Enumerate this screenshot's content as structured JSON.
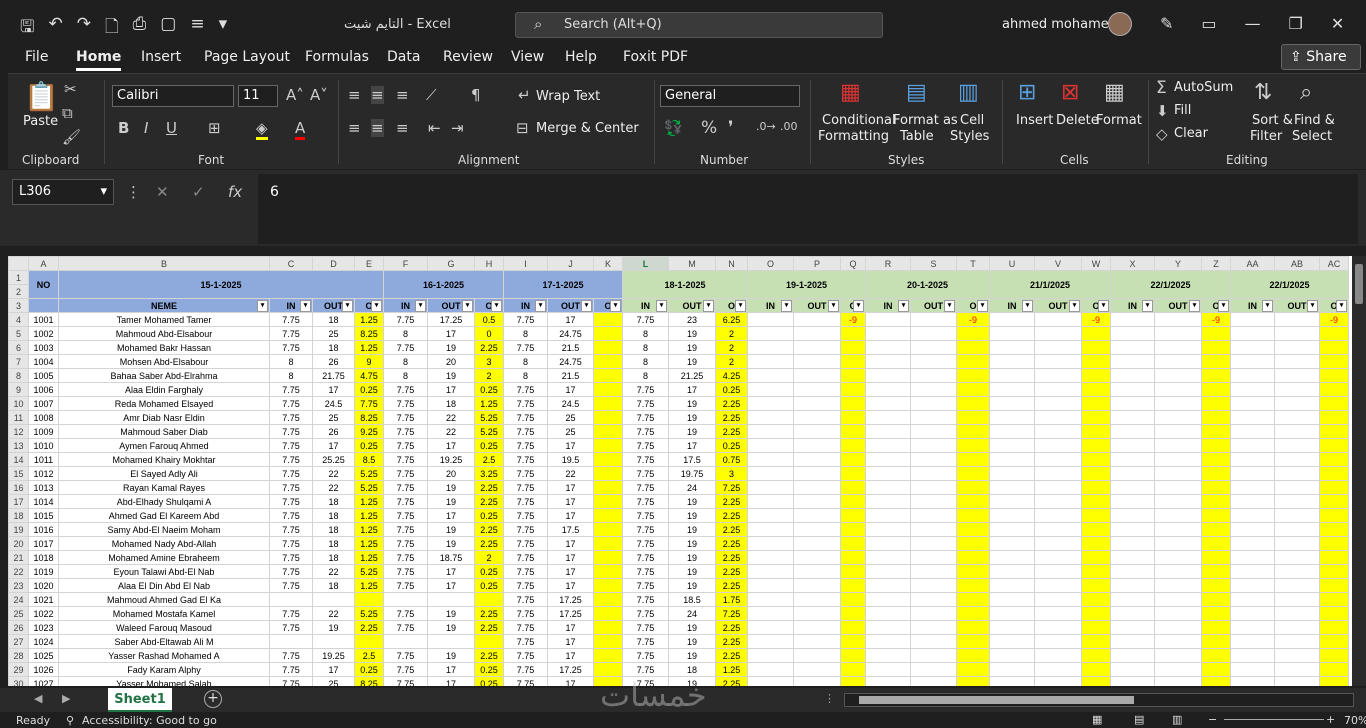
{
  "title_bar": {
    "document_title": "التايم شيت - Excel",
    "search_label": "Search (Alt+Q)",
    "user_name": "ahmed mohamed"
  },
  "menu": [
    "File",
    "Home",
    "Insert",
    "Page Layout",
    "Formulas",
    "Data",
    "Review",
    "View",
    "Help",
    "Foxit PDF"
  ],
  "share_label": "Share",
  "ribbon": {
    "paste": "Paste",
    "font_name": "Calibri",
    "font_size": "11",
    "wrap_text": "Wrap Text",
    "merge_center": "Merge & Center",
    "number_format": "General",
    "conditional_formatting": [
      "Conditional",
      "Formatting"
    ],
    "format_as_table": [
      "Format as",
      "Table"
    ],
    "cell_styles": [
      "Cell",
      "Styles"
    ],
    "insert": "Insert",
    "delete": "Delete",
    "format": "Format",
    "autosum": "AutoSum",
    "fill": "Fill",
    "clear": "Clear",
    "sort_filter": [
      "Sort &",
      "Filter"
    ],
    "find_select": [
      "Find &",
      "Select"
    ],
    "groups": [
      "Clipboard",
      "Font",
      "Alignment",
      "Number",
      "Styles",
      "Cells",
      "Editing"
    ]
  },
  "formula_bar": {
    "name_box": "L306",
    "formula": "6",
    "fx": "fx"
  },
  "sheet": {
    "columns": [
      "A",
      "B",
      "C",
      "D",
      "E",
      "F",
      "G",
      "H",
      "I",
      "J",
      "K",
      "L",
      "M",
      "N",
      "O",
      "P",
      "Q",
      "R",
      "S",
      "T",
      "U",
      "V",
      "W",
      "X",
      "Y",
      "Z",
      "AA",
      "AB",
      "AC"
    ],
    "selected_column": "L",
    "no_header": "NO",
    "name_header": "NEME",
    "dates": [
      "15-1-2025",
      "16-1-2025",
      "17-1-2025",
      "18-1-2025",
      "19-1-2025",
      "20-1-2025",
      "21/1/2025",
      "22/1/2025",
      "22/1/2025"
    ],
    "sub_headers": [
      "IN",
      "OUT",
      "O"
    ],
    "rows": [
      {
        "no": "1001",
        "name": "Tamer Mohamed Tamer",
        "d": [
          [
            "7.75",
            "18",
            "1.25"
          ],
          [
            "7.75",
            "17.25",
            "0.5"
          ],
          [
            "7.75",
            "17",
            ""
          ],
          [
            "7.75",
            "23",
            "6.25"
          ]
        ],
        "neg": "-9"
      },
      {
        "no": "1002",
        "name": "Mahmoud Abd-Elsabour",
        "d": [
          [
            "7.75",
            "25",
            "8.25"
          ],
          [
            "8",
            "17",
            "0"
          ],
          [
            "8",
            "24.75",
            ""
          ],
          [
            "8",
            "19",
            "2"
          ]
        ]
      },
      {
        "no": "1003",
        "name": "Mohamed Bakr Hassan",
        "d": [
          [
            "7.75",
            "18",
            "1.25"
          ],
          [
            "7.75",
            "19",
            "2.25"
          ],
          [
            "7.75",
            "21.5",
            ""
          ],
          [
            "8",
            "19",
            "2"
          ]
        ]
      },
      {
        "no": "1004",
        "name": "Mohsen Abd-Elsabour",
        "d": [
          [
            "8",
            "26",
            "9"
          ],
          [
            "8",
            "20",
            "3"
          ],
          [
            "8",
            "24.75",
            ""
          ],
          [
            "8",
            "19",
            "2"
          ]
        ]
      },
      {
        "no": "1005",
        "name": "Bahaa Saber Abd-Elrahma",
        "d": [
          [
            "8",
            "21.75",
            "4.75"
          ],
          [
            "8",
            "19",
            "2"
          ],
          [
            "8",
            "21.5",
            ""
          ],
          [
            "8",
            "21.25",
            "4.25"
          ]
        ]
      },
      {
        "no": "1006",
        "name": "Alaa Eldin Farghaly",
        "d": [
          [
            "7.75",
            "17",
            "0.25"
          ],
          [
            "7.75",
            "17",
            "0.25"
          ],
          [
            "7.75",
            "17",
            ""
          ],
          [
            "7.75",
            "17",
            "0.25"
          ]
        ]
      },
      {
        "no": "1007",
        "name": "Reda Mohamed Elsayed",
        "d": [
          [
            "7.75",
            "24.5",
            "7.75"
          ],
          [
            "7.75",
            "18",
            "1.25"
          ],
          [
            "7.75",
            "24.5",
            ""
          ],
          [
            "7.75",
            "19",
            "2.25"
          ]
        ]
      },
      {
        "no": "1008",
        "name": "Amr Diab Nasr Eldin",
        "d": [
          [
            "7.75",
            "25",
            "8.25"
          ],
          [
            "7.75",
            "22",
            "5.25"
          ],
          [
            "7.75",
            "25",
            ""
          ],
          [
            "7.75",
            "19",
            "2.25"
          ]
        ]
      },
      {
        "no": "1009",
        "name": "Mahmoud Saber Diab",
        "d": [
          [
            "7.75",
            "26",
            "9.25"
          ],
          [
            "7.75",
            "22",
            "5.25"
          ],
          [
            "7.75",
            "25",
            ""
          ],
          [
            "7.75",
            "19",
            "2.25"
          ]
        ]
      },
      {
        "no": "1010",
        "name": "Aymen Farouq Ahmed",
        "d": [
          [
            "7.75",
            "17",
            "0.25"
          ],
          [
            "7.75",
            "17",
            "0.25"
          ],
          [
            "7.75",
            "17",
            ""
          ],
          [
            "7.75",
            "17",
            "0.25"
          ]
        ]
      },
      {
        "no": "1011",
        "name": "Mohamed Khairy Mokhtar",
        "d": [
          [
            "7.75",
            "25.25",
            "8.5"
          ],
          [
            "7.75",
            "19.25",
            "2.5"
          ],
          [
            "7.75",
            "19.5",
            ""
          ],
          [
            "7.75",
            "17.5",
            "0.75"
          ]
        ]
      },
      {
        "no": "1012",
        "name": "El Sayed Adly Ali",
        "d": [
          [
            "7.75",
            "22",
            "5.25"
          ],
          [
            "7.75",
            "20",
            "3.25"
          ],
          [
            "7.75",
            "22",
            ""
          ],
          [
            "7.75",
            "19.75",
            "3"
          ]
        ]
      },
      {
        "no": "1013",
        "name": "Rayan Kamal Rayes",
        "d": [
          [
            "7.75",
            "22",
            "5.25"
          ],
          [
            "7.75",
            "19",
            "2.25"
          ],
          [
            "7.75",
            "17",
            ""
          ],
          [
            "7.75",
            "24",
            "7.25"
          ]
        ]
      },
      {
        "no": "1014",
        "name": "Abd-Elhady  Shulqami  A",
        "d": [
          [
            "7.75",
            "18",
            "1.25"
          ],
          [
            "7.75",
            "19",
            "2.25"
          ],
          [
            "7.75",
            "17",
            ""
          ],
          [
            "7.75",
            "19",
            "2.25"
          ]
        ]
      },
      {
        "no": "1015",
        "name": "Ahmed Gad El Kareem Abd",
        "d": [
          [
            "7.75",
            "18",
            "1.25"
          ],
          [
            "7.75",
            "17",
            "0.25"
          ],
          [
            "7.75",
            "17",
            ""
          ],
          [
            "7.75",
            "19",
            "2.25"
          ]
        ]
      },
      {
        "no": "1016",
        "name": "Samy Abd-El Naeim Moham",
        "d": [
          [
            "7.75",
            "18",
            "1.25"
          ],
          [
            "7.75",
            "19",
            "2.25"
          ],
          [
            "7.75",
            "17.5",
            ""
          ],
          [
            "7.75",
            "19",
            "2.25"
          ]
        ]
      },
      {
        "no": "1017",
        "name": "Mohamed Nady Abd-Allah",
        "d": [
          [
            "7.75",
            "18",
            "1.25"
          ],
          [
            "7.75",
            "19",
            "2.25"
          ],
          [
            "7.75",
            "17",
            ""
          ],
          [
            "7.75",
            "19",
            "2.25"
          ]
        ]
      },
      {
        "no": "1018",
        "name": "Mohamed Amine Ebraheem",
        "d": [
          [
            "7.75",
            "18",
            "1.25"
          ],
          [
            "7.75",
            "18.75",
            "2"
          ],
          [
            "7.75",
            "17",
            ""
          ],
          [
            "7.75",
            "19",
            "2.25"
          ]
        ]
      },
      {
        "no": "1019",
        "name": "Eyoun Talawi Abd-El Nab",
        "d": [
          [
            "7.75",
            "22",
            "5.25"
          ],
          [
            "7.75",
            "17",
            "0.25"
          ],
          [
            "7.75",
            "17",
            ""
          ],
          [
            "7.75",
            "19",
            "2.25"
          ]
        ]
      },
      {
        "no": "1020",
        "name": "Alaa El Din Abd El Nab",
        "d": [
          [
            "7.75",
            "18",
            "1.25"
          ],
          [
            "7.75",
            "17",
            "0.25"
          ],
          [
            "7.75",
            "17",
            ""
          ],
          [
            "7.75",
            "19",
            "2.25"
          ]
        ]
      },
      {
        "no": "1021",
        "name": "Mahmoud Ahmed Gad El Ka",
        "d": [
          [
            "",
            "",
            ""
          ],
          [
            "",
            "",
            ""
          ],
          [
            "7.75",
            "17.25",
            ""
          ],
          [
            "7.75",
            "18.5",
            "1.75"
          ]
        ]
      },
      {
        "no": "1022",
        "name": "Mohamed Mostafa Kamel",
        "d": [
          [
            "7.75",
            "22",
            "5.25"
          ],
          [
            "7.75",
            "19",
            "2.25"
          ],
          [
            "7.75",
            "17.25",
            ""
          ],
          [
            "7.75",
            "24",
            "7.25"
          ]
        ]
      },
      {
        "no": "1023",
        "name": "Waleed Farouq Masoud",
        "d": [
          [
            "7.75",
            "19",
            "2.25"
          ],
          [
            "7.75",
            "19",
            "2.25"
          ],
          [
            "7.75",
            "17",
            ""
          ],
          [
            "7.75",
            "19",
            "2.25"
          ]
        ]
      },
      {
        "no": "1024",
        "name": "Saber Abd-Eltawab Ali M",
        "d": [
          [
            "",
            "",
            ""
          ],
          [
            "",
            "",
            ""
          ],
          [
            "7.75",
            "17",
            ""
          ],
          [
            "7.75",
            "19",
            "2.25"
          ]
        ]
      },
      {
        "no": "1025",
        "name": "Yasser Rashad Mohamed A",
        "d": [
          [
            "7.75",
            "19.25",
            "2.5"
          ],
          [
            "7.75",
            "19",
            "2.25"
          ],
          [
            "7.75",
            "17",
            ""
          ],
          [
            "7.75",
            "19",
            "2.25"
          ]
        ]
      },
      {
        "no": "1026",
        "name": "Fady Karam Alphy",
        "d": [
          [
            "7.75",
            "17",
            "0.25"
          ],
          [
            "7.75",
            "17",
            "0.25"
          ],
          [
            "7.75",
            "17.25",
            ""
          ],
          [
            "7.75",
            "18",
            "1.25"
          ]
        ]
      },
      {
        "no": "1027",
        "name": "Yasser Mohamed Salah",
        "d": [
          [
            "7.75",
            "25",
            "8.25"
          ],
          [
            "7.75",
            "17",
            "0.25"
          ],
          [
            "7.75",
            "17",
            ""
          ],
          [
            "7.75",
            "19",
            "2.25"
          ]
        ]
      }
    ]
  },
  "sheet_tab": "Sheet1",
  "status": {
    "ready": "Ready",
    "accessibility": "Accessibility: Good to go",
    "zoom": "70%"
  },
  "watermark": "خمسات",
  "colors": {
    "header_blue": "#8ea9db",
    "header_green": "#c6e0b4",
    "overtime_yellow": "#ffff00",
    "negative_red": "#ff0000",
    "excel_green": "#217346"
  }
}
